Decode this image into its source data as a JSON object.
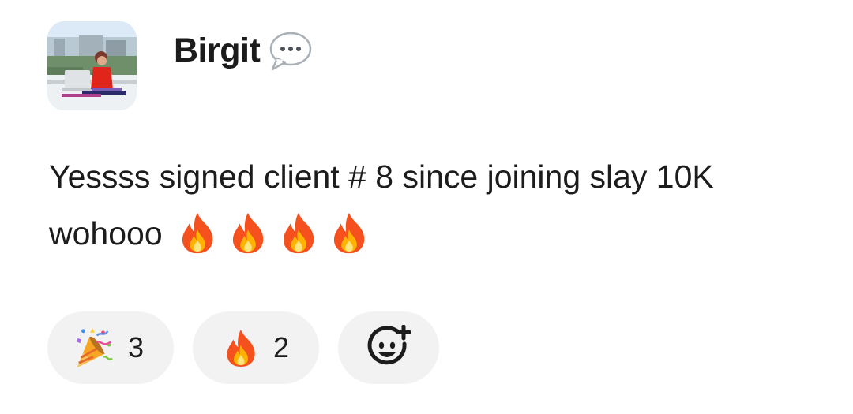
{
  "message": {
    "author": "Birgit",
    "text_line_1": "Yessss signed client # 8 since joining slay 10K",
    "text_line_2": "wohooo",
    "trailing_emoji": [
      "fire-icon",
      "fire-icon",
      "fire-icon",
      "fire-icon"
    ]
  },
  "status_icon": "speech-bubble-icon",
  "reactions": [
    {
      "emoji": "party-popper-icon",
      "count": "3"
    },
    {
      "emoji": "fire-icon",
      "count": "2"
    }
  ],
  "add_reaction_icon": "add-reaction-icon",
  "colors": {
    "text": "#1d1c1d",
    "pill_background": "#f2f2f2",
    "fire_outer": "#f4511e",
    "fire_inner": "#ffb300"
  }
}
